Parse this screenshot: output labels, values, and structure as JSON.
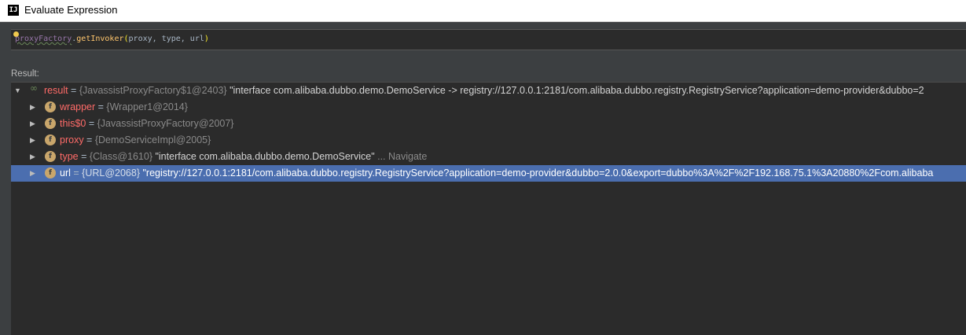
{
  "window": {
    "title": "Evaluate Expression",
    "app_icon": "IJ"
  },
  "expression": {
    "field": "proxyFactory",
    "dot": ".",
    "method": "getInvoker",
    "open": "(",
    "args": "proxy, type, url",
    "close": ")"
  },
  "result_label": "Result:",
  "tree": [
    {
      "name": "result",
      "eq": " = ",
      "ref": "{JavassistProxyFactory$1@2403}",
      "value": " \"interface com.alibaba.dubbo.demo.DemoService -> registry://127.0.0.1:2181/com.alibaba.dubbo.registry.RegistryService?application=demo-provider&dubbo=2",
      "nav": "",
      "expanded": true
    },
    {
      "name": "wrapper",
      "eq": " = ",
      "ref": "{Wrapper1@2014}",
      "value": "",
      "nav": ""
    },
    {
      "name": "this$0",
      "eq": " = ",
      "ref": "{JavassistProxyFactory@2007}",
      "value": "",
      "nav": ""
    },
    {
      "name": "proxy",
      "eq": " = ",
      "ref": "{DemoServiceImpl@2005}",
      "value": "",
      "nav": ""
    },
    {
      "name": "type",
      "eq": " = ",
      "ref": "{Class@1610}",
      "value": " \"interface com.alibaba.dubbo.demo.DemoService\"",
      "nav": " ... Navigate"
    },
    {
      "name": "url",
      "eq": " = ",
      "ref": "{URL@2068}",
      "value": " \"registry://127.0.0.1:2181/com.alibaba.dubbo.registry.RegistryService?application=demo-provider&dubbo=2.0.0&export=dubbo%3A%2F%2F192.168.75.1%3A20880%2Fcom.alibaba",
      "nav": "",
      "selected": true
    }
  ]
}
